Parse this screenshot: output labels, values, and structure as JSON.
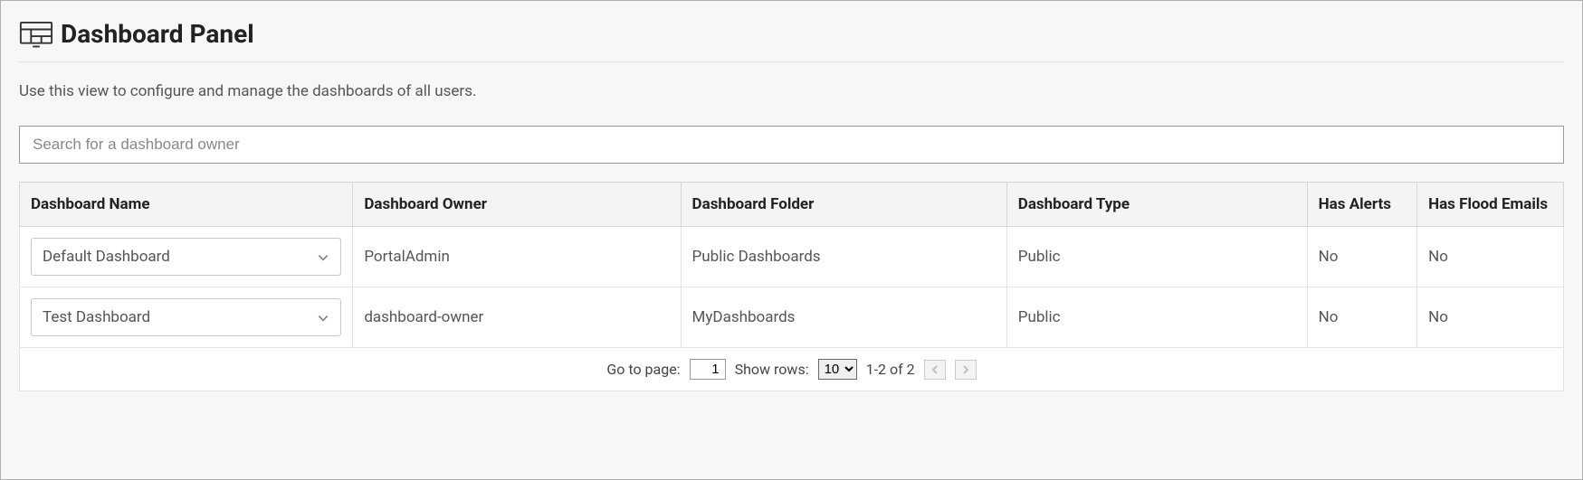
{
  "header": {
    "title": "Dashboard Panel"
  },
  "description": "Use this view to configure and manage the dashboards of all users.",
  "search": {
    "placeholder": "Search for a dashboard owner",
    "value": ""
  },
  "table": {
    "columns": {
      "name": "Dashboard Name",
      "owner": "Dashboard Owner",
      "folder": "Dashboard Folder",
      "type": "Dashboard Type",
      "alerts": "Has Alerts",
      "flood": "Has Flood Emails"
    },
    "rows": [
      {
        "name": "Default Dashboard",
        "owner": "PortalAdmin",
        "folder": "Public Dashboards",
        "type": "Public",
        "alerts": "No",
        "flood": "No"
      },
      {
        "name": "Test Dashboard",
        "owner": "dashboard-owner",
        "folder": "MyDashboards",
        "type": "Public",
        "alerts": "No",
        "flood": "No"
      }
    ]
  },
  "pager": {
    "goto_label": "Go to page:",
    "page": "1",
    "showrows_label": "Show rows:",
    "rows_options": [
      "10"
    ],
    "rows_selected": "10",
    "range_text": "1-2 of 2"
  }
}
